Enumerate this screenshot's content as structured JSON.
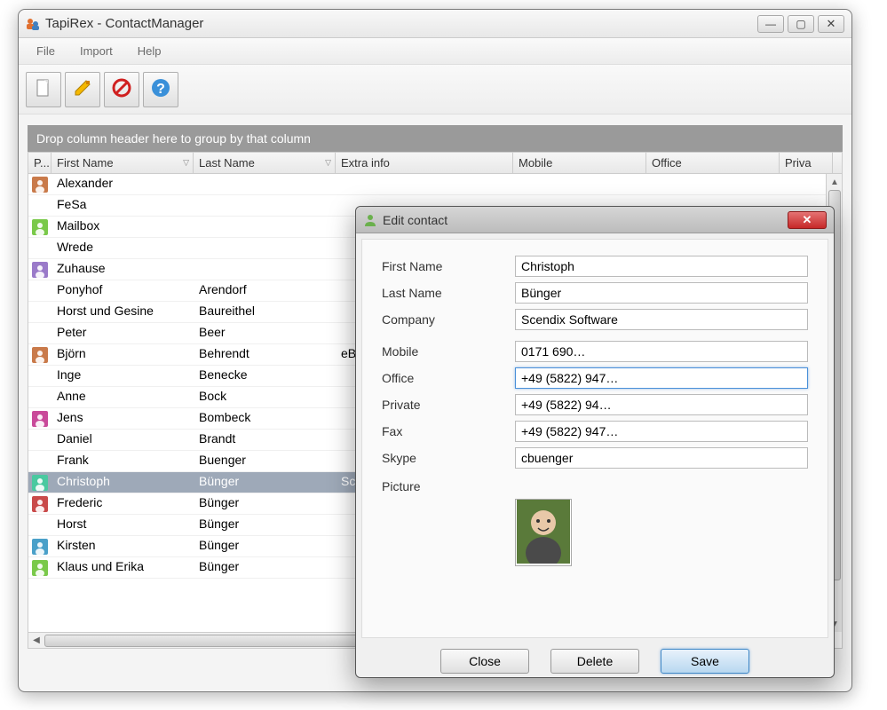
{
  "window": {
    "title": "TapiRex - ContactManager"
  },
  "menu": {
    "items": [
      "File",
      "Import",
      "Help"
    ]
  },
  "toolbar": {
    "buttons": [
      "new",
      "edit",
      "delete",
      "help"
    ]
  },
  "group_header": "Drop column header here to group by that column",
  "columns": {
    "p": "P...",
    "first_name": "First Name",
    "last_name": "Last Name",
    "extra_info": "Extra info",
    "mobile": "Mobile",
    "office": "Office",
    "private": "Priva"
  },
  "rows": [
    {
      "has_avatar": true,
      "first_name": "Alexander",
      "last_name": "",
      "extra_info": "",
      "selected": false
    },
    {
      "has_avatar": false,
      "first_name": "FeSa",
      "last_name": "",
      "extra_info": "",
      "selected": false
    },
    {
      "has_avatar": true,
      "first_name": "Mailbox",
      "last_name": "",
      "extra_info": "",
      "selected": false
    },
    {
      "has_avatar": false,
      "first_name": "Wrede",
      "last_name": "",
      "extra_info": "",
      "selected": false
    },
    {
      "has_avatar": true,
      "first_name": "Zuhause",
      "last_name": "",
      "extra_info": "",
      "selected": false
    },
    {
      "has_avatar": false,
      "first_name": "Ponyhof",
      "last_name": "Arendorf",
      "extra_info": "",
      "selected": false
    },
    {
      "has_avatar": false,
      "first_name": "Horst und Gesine",
      "last_name": "Baureithel",
      "extra_info": "",
      "selected": false
    },
    {
      "has_avatar": false,
      "first_name": "Peter",
      "last_name": "Beer",
      "extra_info": "",
      "selected": false
    },
    {
      "has_avatar": true,
      "first_name": "Björn",
      "last_name": "Behrendt",
      "extra_info": "eB",
      "selected": false
    },
    {
      "has_avatar": false,
      "first_name": "Inge",
      "last_name": "Benecke",
      "extra_info": "",
      "selected": false
    },
    {
      "has_avatar": false,
      "first_name": "Anne",
      "last_name": "Bock",
      "extra_info": "",
      "selected": false
    },
    {
      "has_avatar": true,
      "first_name": "Jens",
      "last_name": "Bombeck",
      "extra_info": "",
      "selected": false
    },
    {
      "has_avatar": false,
      "first_name": "Daniel",
      "last_name": "Brandt",
      "extra_info": "",
      "selected": false
    },
    {
      "has_avatar": false,
      "first_name": "Frank",
      "last_name": "Buenger",
      "extra_info": "",
      "selected": false
    },
    {
      "has_avatar": true,
      "first_name": "Christoph",
      "last_name": "Bünger",
      "extra_info": "Sc",
      "selected": true
    },
    {
      "has_avatar": true,
      "first_name": "Frederic",
      "last_name": "Bünger",
      "extra_info": "",
      "selected": false
    },
    {
      "has_avatar": false,
      "first_name": "Horst",
      "last_name": "Bünger",
      "extra_info": "",
      "selected": false
    },
    {
      "has_avatar": true,
      "first_name": "Kirsten",
      "last_name": "Bünger",
      "extra_info": "",
      "selected": false
    },
    {
      "has_avatar": true,
      "first_name": "Klaus und Erika",
      "last_name": "Bünger",
      "extra_info": "",
      "selected": false
    }
  ],
  "dialog": {
    "title": "Edit contact",
    "labels": {
      "first_name": "First Name",
      "last_name": "Last Name",
      "company": "Company",
      "mobile": "Mobile",
      "office": "Office",
      "private": "Private",
      "fax": "Fax",
      "skype": "Skype",
      "picture": "Picture"
    },
    "values": {
      "first_name": "Christoph",
      "last_name": "Bünger",
      "company": "Scendix Software",
      "mobile": "0171 690…",
      "office": "+49 (5822) 947…",
      "private": "+49 (5822) 94…",
      "fax": "+49 (5822) 947…",
      "skype": "cbuenger"
    },
    "buttons": {
      "close": "Close",
      "delete": "Delete",
      "save": "Save"
    }
  }
}
